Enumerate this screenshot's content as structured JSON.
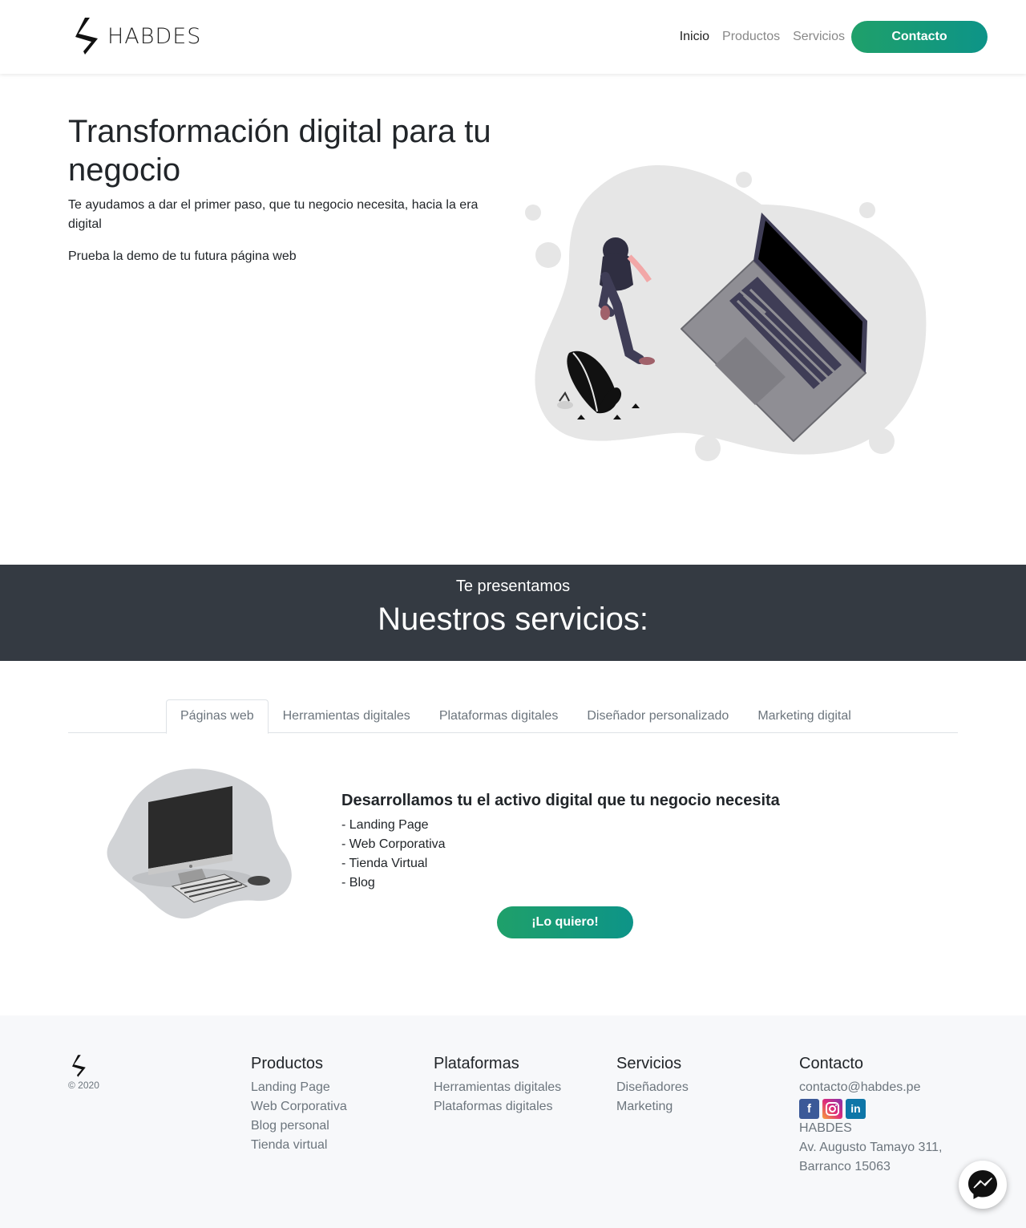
{
  "brand": {
    "name": "HABDES"
  },
  "nav": {
    "items": [
      {
        "label": "Inicio",
        "active": true
      },
      {
        "label": "Productos",
        "active": false
      },
      {
        "label": "Servicios",
        "active": false
      }
    ],
    "contact_label": "Contacto"
  },
  "hero": {
    "title": "Transformación digital para tu negocio",
    "subtitle": "Te ayudamos a dar el primer paso, que tu negocio necesita, hacia la era digital",
    "demo_text": "Prueba la demo de tu futura página web"
  },
  "band": {
    "subtitle": "Te presentamos",
    "title": "Nuestros servicios:"
  },
  "tabs": [
    {
      "label": "Páginas web",
      "active": true
    },
    {
      "label": "Herramientas digitales",
      "active": false
    },
    {
      "label": "Plataformas digitales",
      "active": false
    },
    {
      "label": "Diseñador personalizado",
      "active": false
    },
    {
      "label": "Marketing digital",
      "active": false
    }
  ],
  "service": {
    "title": "Desarrollamos tu el activo digital que tu negocio necesita",
    "items": [
      "- Landing Page",
      "- Web Corporativa",
      "- Tienda Virtual",
      "- Blog"
    ],
    "cta": "¡Lo quiero!"
  },
  "footer": {
    "copyright": "© 2020",
    "productos": {
      "title": "Productos",
      "links": [
        "Landing Page",
        "Web Corporativa",
        "Blog personal",
        "Tienda virtual"
      ]
    },
    "plataformas": {
      "title": "Plataformas",
      "links": [
        "Herramientas digitales",
        "Plataformas digitales"
      ]
    },
    "servicios": {
      "title": "Servicios",
      "links": [
        "Diseñadores",
        "Marketing"
      ]
    },
    "contacto": {
      "title": "Contacto",
      "email": "contacto@habdes.pe",
      "social_icons": [
        "facebook-icon",
        "instagram-icon",
        "linkedin-icon"
      ],
      "company": "HABDES",
      "address_line1": "Av. Augusto Tamayo 311,",
      "address_line2": "Barranco 15063"
    }
  },
  "colors": {
    "accent_start": "#1fa06a",
    "accent_end": "#0d9488",
    "band_bg": "#343a42",
    "footer_bg": "#f7f8fa"
  },
  "icons": {
    "brand_logo": "habdes-logo-icon",
    "chat": "messenger-icon"
  }
}
